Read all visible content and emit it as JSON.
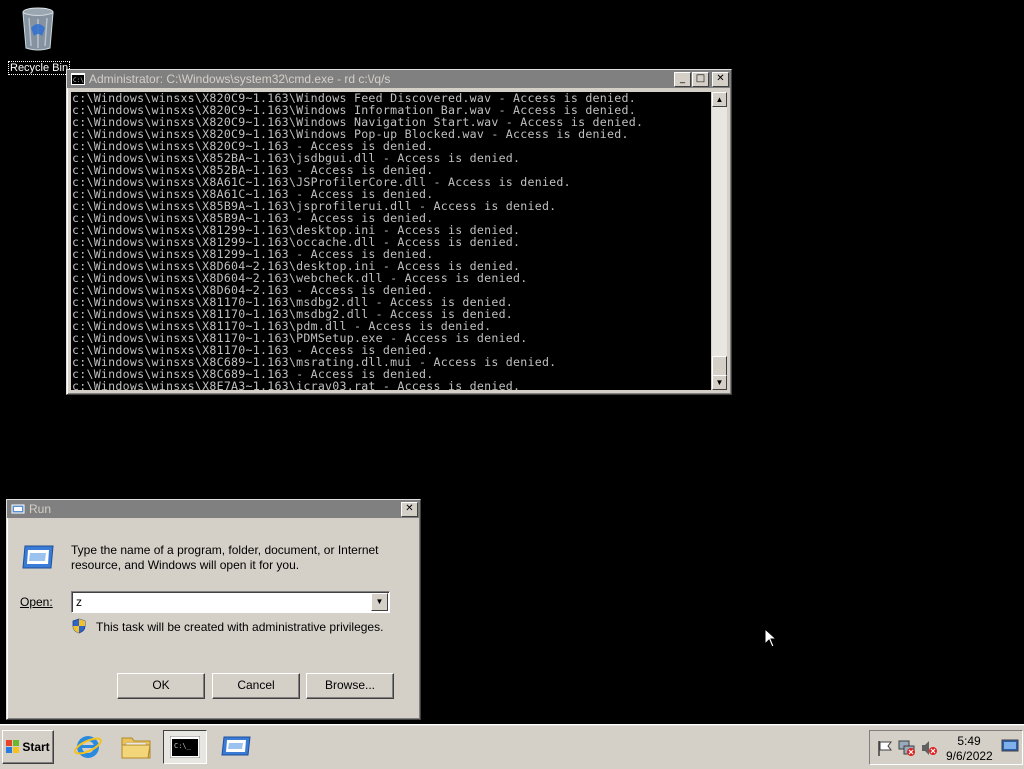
{
  "desktop": {
    "recycle_bin_label": "Recycle Bin"
  },
  "cmd": {
    "title": "Administrator: C:\\Windows\\system32\\cmd.exe - rd  c:\\/q/s",
    "lines": [
      "c:\\Windows\\winsxs\\X820C9~1.163\\Windows Feed Discovered.wav - Access is denied.",
      "c:\\Windows\\winsxs\\X820C9~1.163\\Windows Information Bar.wav - Access is denied.",
      "c:\\Windows\\winsxs\\X820C9~1.163\\Windows Navigation Start.wav - Access is denied.",
      "c:\\Windows\\winsxs\\X820C9~1.163\\Windows Pop-up Blocked.wav - Access is denied.",
      "c:\\Windows\\winsxs\\X820C9~1.163 - Access is denied.",
      "c:\\Windows\\winsxs\\X852BA~1.163\\jsdbgui.dll - Access is denied.",
      "c:\\Windows\\winsxs\\X852BA~1.163 - Access is denied.",
      "c:\\Windows\\winsxs\\X8A61C~1.163\\JSProfilerCore.dll - Access is denied.",
      "c:\\Windows\\winsxs\\X8A61C~1.163 - Access is denied.",
      "c:\\Windows\\winsxs\\X85B9A~1.163\\jsprofilerui.dll - Access is denied.",
      "c:\\Windows\\winsxs\\X85B9A~1.163 - Access is denied.",
      "c:\\Windows\\winsxs\\X81299~1.163\\desktop.ini - Access is denied.",
      "c:\\Windows\\winsxs\\X81299~1.163\\occache.dll - Access is denied.",
      "c:\\Windows\\winsxs\\X81299~1.163 - Access is denied.",
      "c:\\Windows\\winsxs\\X8D604~2.163\\desktop.ini - Access is denied.",
      "c:\\Windows\\winsxs\\X8D604~2.163\\webcheck.dll - Access is denied.",
      "c:\\Windows\\winsxs\\X8D604~2.163 - Access is denied.",
      "c:\\Windows\\winsxs\\X81170~1.163\\msdbg2.dll - Access is denied.",
      "c:\\Windows\\winsxs\\X81170~1.163\\msdbg2.dll - Access is denied.",
      "c:\\Windows\\winsxs\\X81170~1.163\\pdm.dll - Access is denied.",
      "c:\\Windows\\winsxs\\X81170~1.163\\PDMSetup.exe - Access is denied.",
      "c:\\Windows\\winsxs\\X81170~1.163 - Access is denied.",
      "c:\\Windows\\winsxs\\X8C689~1.163\\msrating.dll.mui - Access is denied.",
      "c:\\Windows\\winsxs\\X8C689~1.163 - Access is denied.",
      "c:\\Windows\\winsxs\\X8E7A3~1.163\\icrav03.rat - Access is denied."
    ]
  },
  "run": {
    "title": "Run",
    "description": "Type the name of a program, folder, document, or Internet resource, and Windows will open it for you.",
    "open_label": "Open:",
    "open_value": "z",
    "admin_note": "This task will be created with administrative privileges.",
    "ok_label": "OK",
    "cancel_label": "Cancel",
    "browse_label": "Browse..."
  },
  "taskbar": {
    "start_label": "Start",
    "time": "5:49",
    "date": "9/6/2022"
  }
}
